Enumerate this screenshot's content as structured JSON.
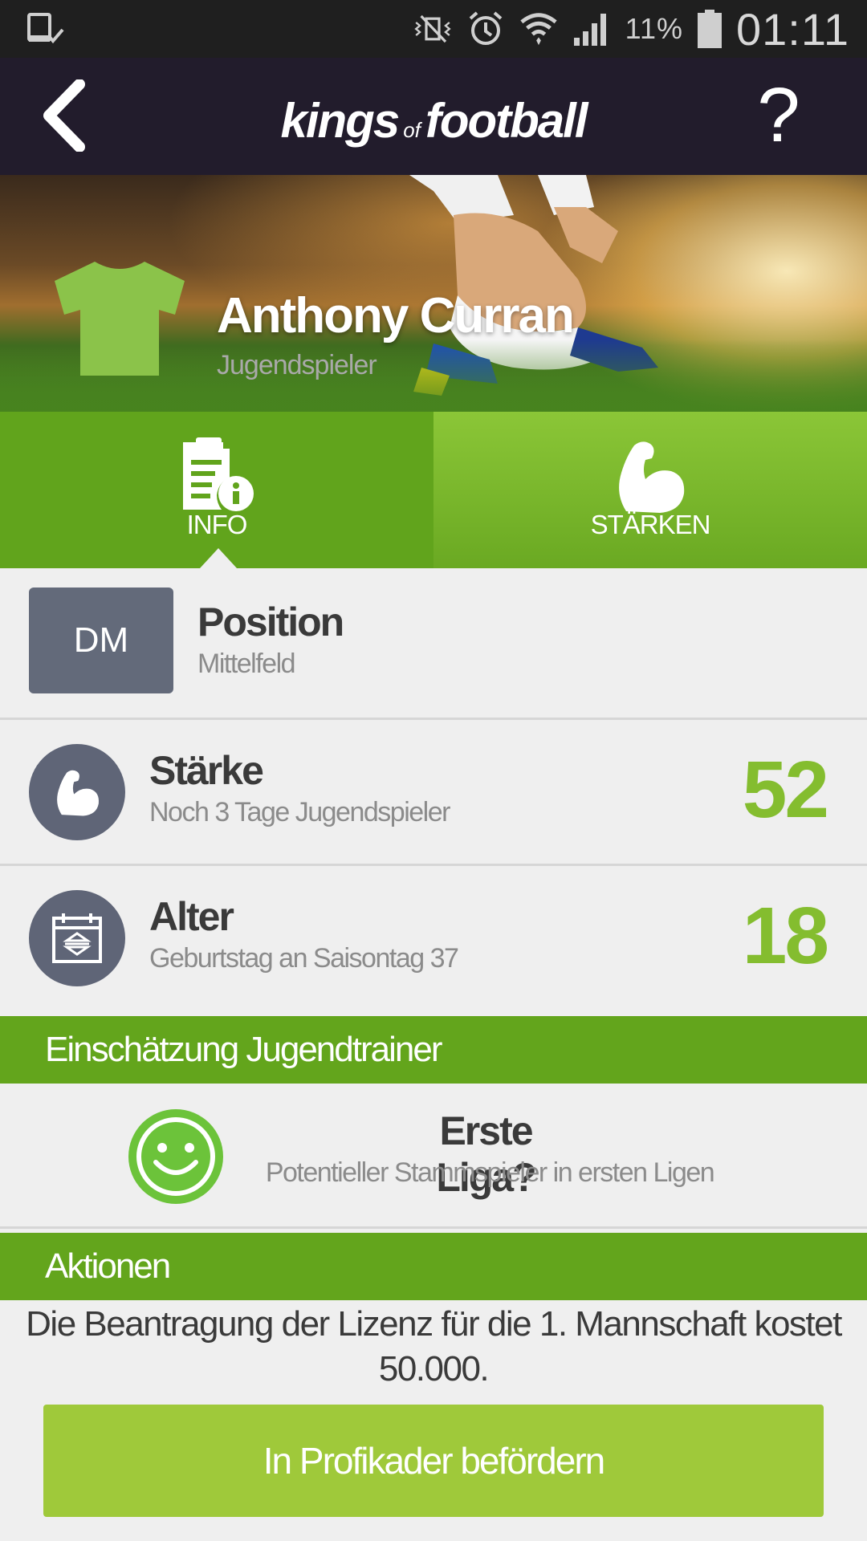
{
  "status_bar": {
    "battery_percent": "11%",
    "time": "01:11"
  },
  "header": {
    "logo_kings": "kings",
    "logo_of": "of",
    "logo_football": "football",
    "help_label": "?"
  },
  "player": {
    "name": "Anthony Curran",
    "role": "Jugendspieler",
    "shirt_color": "#8bc34a"
  },
  "tabs": [
    {
      "label": "INFO",
      "icon": "document-info-icon",
      "active": true
    },
    {
      "label": "STÄRKEN",
      "icon": "flexed-arm-icon",
      "active": false
    }
  ],
  "position": {
    "badge": "DM",
    "title": "Position",
    "subtitle": "Mittelfeld"
  },
  "strength": {
    "title": "Stärke",
    "subtitle": "Noch 3 Tage Jugendspieler",
    "value": "52",
    "icon": "flexed-arm-icon"
  },
  "age": {
    "title": "Alter",
    "subtitle": "Geburtstag an Saisontag 37",
    "value": "18",
    "icon": "calendar-icon"
  },
  "coach_assessment": {
    "header": "Einschätzung Jugendtrainer",
    "title": "Erste Liga?",
    "subtitle": "Potentieller Stammspieler in ersten Ligen",
    "icon": "smiley-icon"
  },
  "actions": {
    "header": "Aktionen",
    "license_text": "Die Beantragung der Lizenz für die 1. Mannschaft kostet 50.000.",
    "promote_button": "In Profikader befördern"
  },
  "colors": {
    "accent_green": "#63a51c",
    "value_green": "#84bd2f",
    "button_green": "#9fc93a",
    "header_dark": "#221c2c",
    "badge_slate": "#636a7a"
  }
}
